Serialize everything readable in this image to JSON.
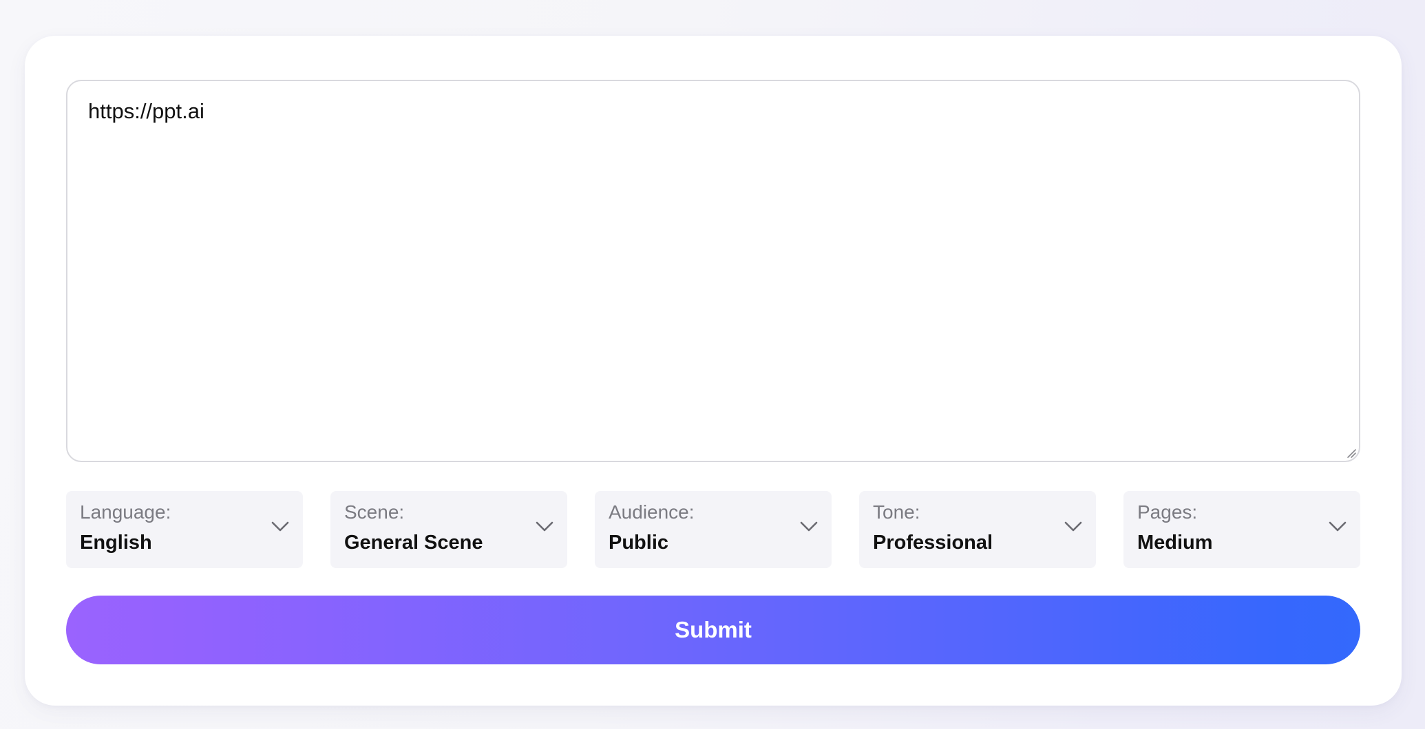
{
  "prompt": {
    "value": "https://ppt.ai"
  },
  "selects": {
    "language": {
      "label": "Language:",
      "value": "English"
    },
    "scene": {
      "label": "Scene:",
      "value": "General Scene"
    },
    "audience": {
      "label": "Audience:",
      "value": "Public"
    },
    "tone": {
      "label": "Tone:",
      "value": "Professional"
    },
    "pages": {
      "label": "Pages:",
      "value": "Medium"
    }
  },
  "submit": {
    "label": "Submit"
  },
  "icons": {
    "select_chevron": "chevron-down-icon",
    "resize": "resize-handle-icon"
  },
  "colors": {
    "submit_gradient_start": "#9a63fe",
    "submit_gradient_end": "#3469fc",
    "select_background": "#f4f4f8",
    "label_text": "#7b7b82"
  }
}
